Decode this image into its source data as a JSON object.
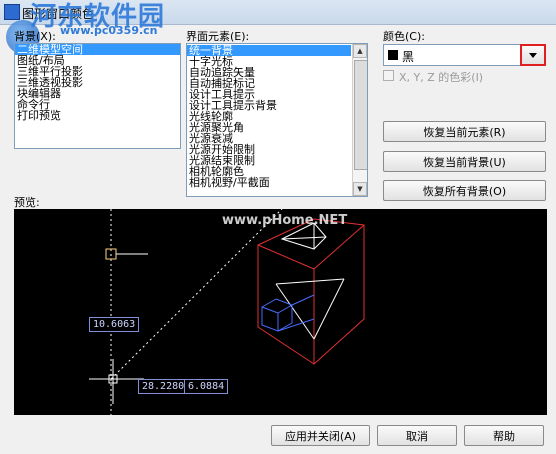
{
  "window": {
    "title": "图形窗口颜色"
  },
  "watermark": {
    "logo_text": "河东软件园",
    "url": "www.pc0359.cn"
  },
  "context": {
    "label": "背景(X):",
    "items": [
      "二维模型空间",
      "图纸/布局",
      "三维平行投影",
      "三维透视投影",
      "块编辑器",
      "命令行",
      "打印预览"
    ],
    "selected_index": 0
  },
  "interface_element": {
    "label": "界面元素(E):",
    "items": [
      "统一背景",
      "十字光标",
      "自动追踪矢量",
      "自动捕捉标记",
      "设计工具提示",
      "设计工具提示背景",
      "光线轮廓",
      "光源聚光角",
      "光源衰减",
      "光源开始限制",
      "光源结束限制",
      "相机轮廓色",
      "相机视野/平截面"
    ],
    "selected_index": 0
  },
  "color": {
    "label": "颜色(C):",
    "value": "黑",
    "swatch": "#000000",
    "tint_label": "X, Y, Z 的色彩(I)",
    "tint_checked": false
  },
  "buttons": {
    "restore_element": "恢复当前元素(R)",
    "restore_context": "恢复当前背景(U)",
    "restore_all": "恢复所有背景(O)",
    "apply_close": "应用并关闭(A)",
    "cancel": "取消",
    "help": "帮助"
  },
  "preview": {
    "label": "预览:",
    "watermark": "www.pHome.NET",
    "coord_1": "10.6063",
    "coord_2": "28.2280",
    "coord_3": "6.0884"
  },
  "colors": {
    "selection": "#3399ff",
    "highlight_border": "#e02020",
    "preview_bg": "#000000"
  },
  "icons": {
    "app": "app-icon",
    "dropdown": "chevron-down-icon",
    "scroll_up": "scroll-up-arrow-icon",
    "scroll_down": "scroll-down-arrow-icon",
    "checkbox": "checkbox-icon",
    "crosshair": "crosshair-icon",
    "camera": "camera-glyph-icon"
  }
}
